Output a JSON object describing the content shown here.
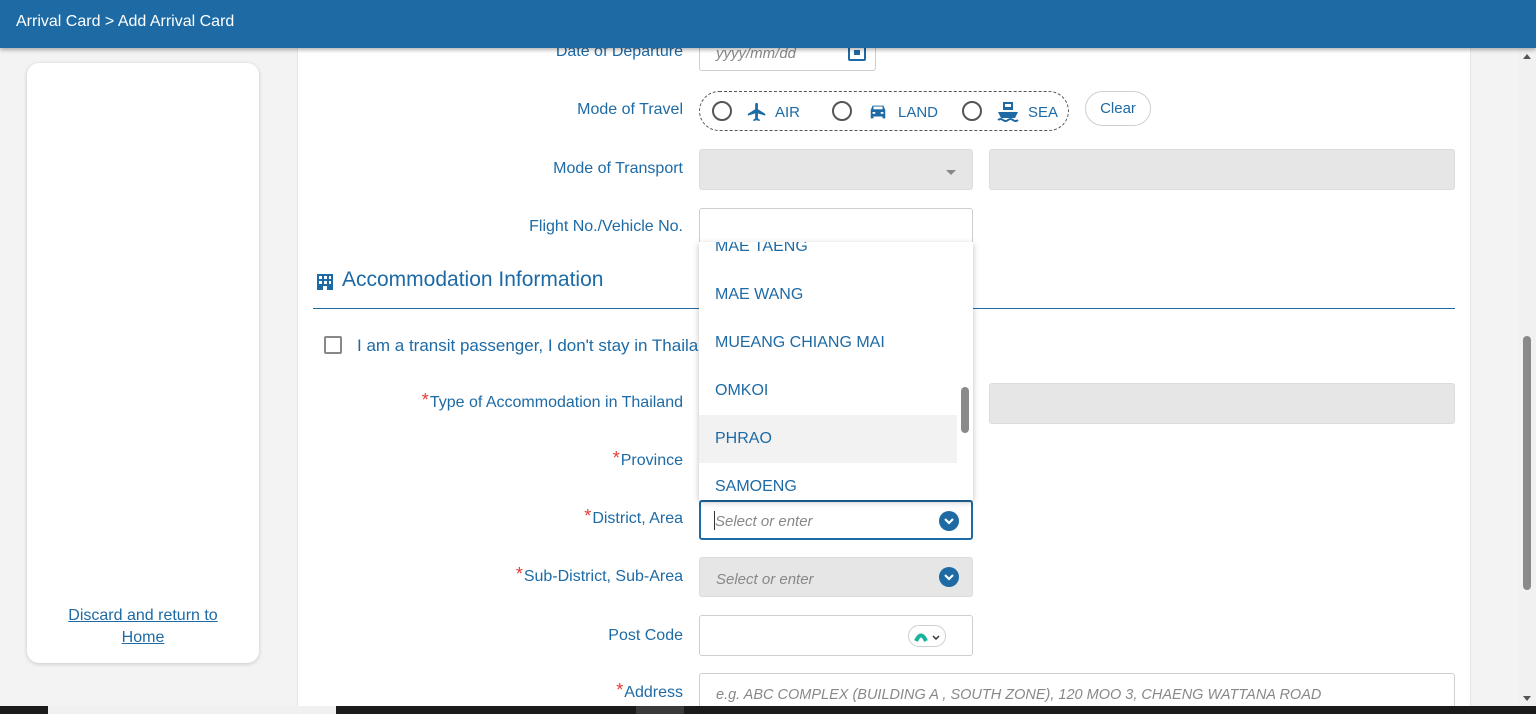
{
  "header": {
    "breadcrumb": "Arrival Card > Add Arrival Card"
  },
  "sidebar": {
    "discard_line1": "Discard and return to",
    "discard_line2": "Home"
  },
  "form": {
    "date_departure": {
      "label": "Date of Departure",
      "placeholder": "yyyy/mm/dd"
    },
    "mode_of_travel": {
      "label": "Mode of Travel",
      "options": [
        "AIR",
        "LAND",
        "SEA"
      ],
      "clear_label": "Clear"
    },
    "mode_of_transport": {
      "label": "Mode of Transport"
    },
    "flight_no": {
      "label": "Flight No./Vehicle No."
    },
    "accommodation_section": {
      "title": "Accommodation Information"
    },
    "transit": {
      "label": "I am a transit passenger, I don't stay in Thailand"
    },
    "type_accommodation": {
      "label": "Type of Accommodation in Thailand",
      "required": "*"
    },
    "province": {
      "label": "Province",
      "required": "*"
    },
    "district": {
      "label": "District, Area",
      "required": "*",
      "placeholder": "Select or enter"
    },
    "sub_district": {
      "label": "Sub-District, Sub-Area",
      "required": "*",
      "placeholder": "Select or enter"
    },
    "post_code": {
      "label": "Post Code"
    },
    "address": {
      "label": "Address",
      "required": "*",
      "placeholder": "e.g. ABC COMPLEX (BUILDING A , SOUTH ZONE), 120 MOO 3, CHAENG WATTANA ROAD"
    }
  },
  "district_dropdown": {
    "options": [
      "MAE TAENG",
      "MAE WANG",
      "MUEANG CHIANG MAI",
      "OMKOI",
      "PHRAO",
      "SAMOENG"
    ],
    "highlighted": "PHRAO"
  },
  "colors": {
    "brand": "#1d6aa5",
    "required": "#e53935",
    "disabled_bg": "#e6e6e6"
  }
}
